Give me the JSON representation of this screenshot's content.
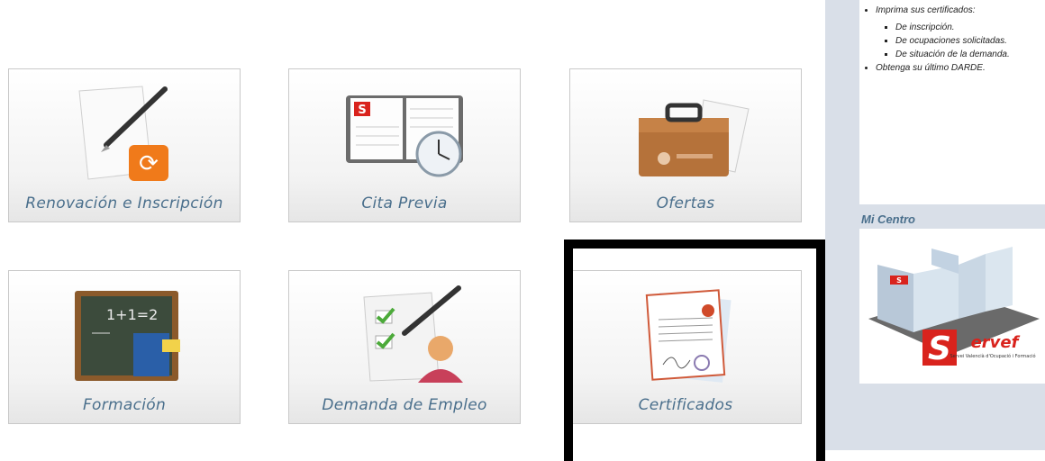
{
  "tiles": [
    {
      "id": "renovacion",
      "label": "Renovación e Inscripción",
      "icon": "pen-renew-icon"
    },
    {
      "id": "cita",
      "label": "Cita Previa",
      "icon": "agenda-clock-icon"
    },
    {
      "id": "ofertas",
      "label": "Ofertas",
      "icon": "briefcase-icon"
    },
    {
      "id": "formacion",
      "label": "Formación",
      "icon": "chalkboard-icon"
    },
    {
      "id": "demanda",
      "label": "Demanda de Empleo",
      "icon": "checklist-person-icon"
    },
    {
      "id": "certificados",
      "label": "Certificados",
      "icon": "certificate-icon"
    }
  ],
  "sidebar": {
    "info": {
      "item1": "Imprima sus certificados:",
      "subitems": [
        "De inscripción.",
        "De ocupaciones solicitadas.",
        "De situación de la demanda."
      ],
      "item2": "Obtenga su último DARDE."
    },
    "centro_title": "Mi Centro",
    "logo_text": "Servef",
    "logo_subtext": "Servei Valencià d'Ocupació i Formació",
    "badge_letter": "S"
  },
  "colors": {
    "label": "#4a6f8c",
    "sidebar_bg": "#d9dfe8",
    "brand_red": "#d9231d"
  }
}
